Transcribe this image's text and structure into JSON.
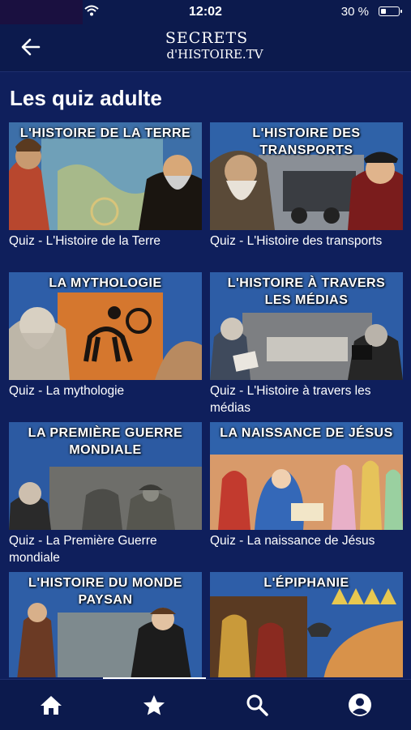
{
  "status_bar": {
    "time": "12:02",
    "battery_percent": "30 %",
    "battery_level": 0.3
  },
  "header": {
    "logo_line1": "SECRETS",
    "logo_line2": "d'HISTOIRE.TV",
    "back_icon": "arrow-left-icon"
  },
  "main": {
    "title": "Les quiz adulte",
    "cards": [
      {
        "banner": "L'HISTOIRE DE LA TERRE",
        "caption": "Quiz - L'Histoire de la Terre"
      },
      {
        "banner": "L'HISTOIRE DES TRANSPORTS",
        "caption": "Quiz - L'Histoire des transports"
      },
      {
        "banner": "LA MYTHOLOGIE",
        "caption": "Quiz - La mythologie"
      },
      {
        "banner": "L'HISTOIRE À TRAVERS LES MÉDIAS",
        "caption": "Quiz - L'Histoire à travers les médias"
      },
      {
        "banner": "LA PREMIÈRE GUERRE MONDIALE",
        "caption": "Quiz - La Première Guerre mondiale"
      },
      {
        "banner": "LA NAISSANCE DE JÉSUS",
        "caption": "Quiz - La naissance de Jésus"
      },
      {
        "banner": "L'HISTOIRE DU MONDE PAYSAN",
        "caption": ""
      },
      {
        "banner": "L'ÉPIPHANIE",
        "caption": ""
      }
    ]
  },
  "tab_bar": {
    "tabs": [
      {
        "icon": "home-icon"
      },
      {
        "icon": "star-icon"
      },
      {
        "icon": "search-icon"
      },
      {
        "icon": "account-icon"
      }
    ],
    "active_tab": 1
  },
  "colors": {
    "background": "#0f1f5c",
    "header": "#0c1a4d",
    "text": "#ffffff"
  }
}
